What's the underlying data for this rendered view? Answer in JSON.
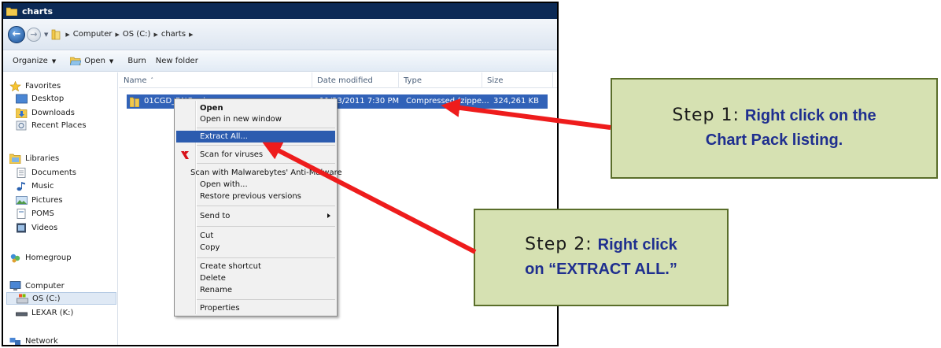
{
  "window": {
    "title": "charts",
    "breadcrumb": [
      "Computer",
      "OS (C:)",
      "charts"
    ]
  },
  "toolbar": {
    "organize_label": "Organize",
    "open_label": "Open",
    "burn_label": "Burn",
    "new_folder_label": "New folder"
  },
  "nav": {
    "favorites": "Favorites",
    "desktop": "Desktop",
    "downloads": "Downloads",
    "recent_places": "Recent Places",
    "libraries": "Libraries",
    "documents": "Documents",
    "music": "Music",
    "pictures": "Pictures",
    "poms": "POMS",
    "videos": "Videos",
    "homegroup": "Homegroup",
    "computer": "Computer",
    "os_c": "OS (C:)",
    "lexar_k": "LEXAR (K:)",
    "network": "Network"
  },
  "columns": {
    "name": "Name",
    "date_modified": "Date modified",
    "type": "Type",
    "size": "Size"
  },
  "file": {
    "name": "01CGD_RNCs.zip",
    "date": "11/23/2011 7:30 PM",
    "type": "Compressed (zippe...",
    "size": "324,261 KB"
  },
  "context_menu": {
    "open": "Open",
    "open_new_window": "Open in new window",
    "extract_all": "Extract All...",
    "scan_viruses": "Scan for viruses",
    "scan_malwarebytes": "Scan with Malwarebytes' Anti-Malware",
    "open_with": "Open with...",
    "restore_previous": "Restore previous versions",
    "send_to": "Send to",
    "cut": "Cut",
    "copy": "Copy",
    "create_shortcut": "Create shortcut",
    "delete": "Delete",
    "rename": "Rename",
    "properties": "Properties"
  },
  "callouts": {
    "step1_label": "Step 1:",
    "step1_text_a": "Right click on the",
    "step1_text_b": "Chart Pack listing.",
    "step2_label": "Step 2:",
    "step2_text_a": "Right click",
    "step2_text_b": "on “EXTRACT ALL.”"
  },
  "colors": {
    "titlebar": "#0c2a56",
    "selection": "#3162b8",
    "menu_highlight": "#2c5caf",
    "callout_fill": "#d6e1b2",
    "callout_text": "#1f2f8f",
    "arrow": "#ee1c1c"
  }
}
